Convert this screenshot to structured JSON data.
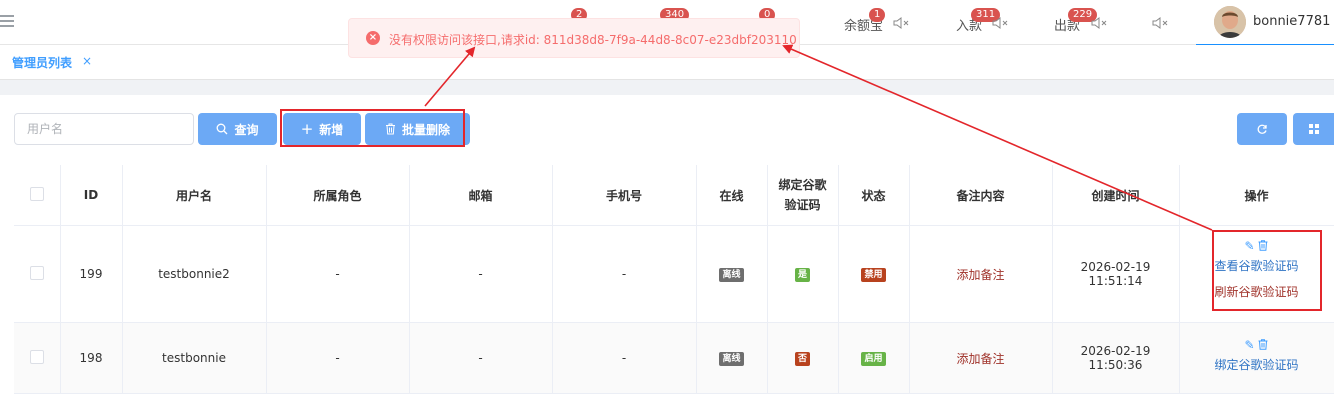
{
  "header": {
    "badges": [
      "2",
      "340",
      "0"
    ],
    "stats": [
      {
        "label": "余额宝",
        "badge": "1"
      },
      {
        "label": "入款",
        "badge": "311"
      },
      {
        "label": "出款",
        "badge": "229"
      }
    ],
    "username": "bonnie7781"
  },
  "tab": {
    "label": "管理员列表",
    "close": "×"
  },
  "toast": {
    "icon": "×",
    "message": "没有权限访问该接口,请求id: 811d38d8-7f9a-44d8-8c07-e23dbf203110"
  },
  "toolbar": {
    "search_placeholder": "用户名",
    "query_label": "查询",
    "add_label": "新增",
    "batch_delete_label": "批量删除"
  },
  "table": {
    "columns": [
      "ID",
      "用户名",
      "所属角色",
      "邮箱",
      "手机号",
      "在线",
      "绑定谷歌验证码",
      "状态",
      "备注内容",
      "创建时间",
      "操作"
    ],
    "rows": [
      {
        "id": "199",
        "username": "testbonnie2",
        "role": "-",
        "email": "-",
        "phone": "-",
        "online": "离线",
        "google_bound": "是",
        "status": "禁用",
        "note": "添加备注",
        "created": "2026-02-19 11:51:14",
        "actions": [
          "查看谷歌验证码",
          "刷新谷歌验证码"
        ]
      },
      {
        "id": "198",
        "username": "testbonnie",
        "role": "-",
        "email": "-",
        "phone": "-",
        "online": "离线",
        "google_bound": "否",
        "status": "启用",
        "note": "添加备注",
        "created": "2026-02-19 11:50:36",
        "actions": [
          "绑定谷歌验证码"
        ]
      }
    ]
  },
  "colors": {
    "primary": "#409eff",
    "button": "#6ca9f5",
    "danger": "#f56c6c",
    "annotation": "#e3262b",
    "badge": "#d9534f"
  }
}
